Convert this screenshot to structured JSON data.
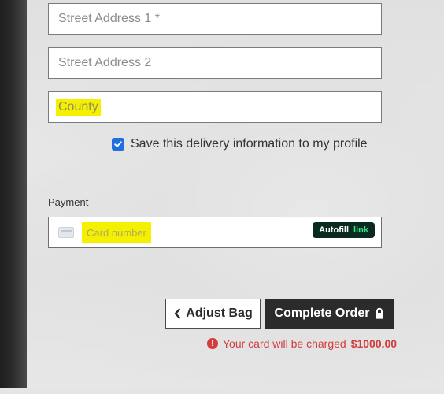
{
  "form": {
    "street1_placeholder": "Street Address 1 *",
    "street2_placeholder": "Street Address 2",
    "county_placeholder": "County",
    "save_profile_label": "Save this delivery information to my profile",
    "save_profile_checked": true
  },
  "payment": {
    "label": "Payment",
    "card_number_placeholder": "Card number",
    "autofill_label": "Autofill",
    "autofill_link": "link"
  },
  "actions": {
    "adjust_bag_label": "Adjust Bag",
    "complete_order_label": "Complete Order"
  },
  "notice": {
    "text": "Your card will be charged",
    "amount": "$1000.00"
  },
  "icons": {
    "adjust_icon": "chevron-left-icon",
    "complete_icon": "lock-icon",
    "checkbox_icon": "check-icon",
    "notice_icon": "exclamation-circle-icon",
    "card_icon": "credit-card-icon"
  },
  "colors": {
    "checkbox": "#1f6fe0",
    "highlight": "#f5f000",
    "primary_button": "#2b2b2b",
    "autofill_bg": "#0b2a1f",
    "autofill_link": "#2ee58a",
    "error_text": "#d23d3d"
  }
}
